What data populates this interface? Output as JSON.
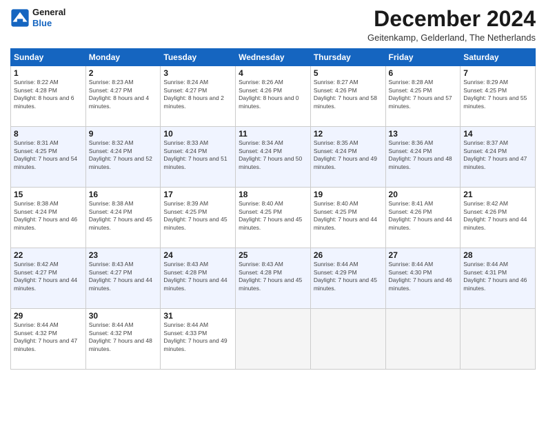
{
  "logo": {
    "line1": "General",
    "line2": "Blue"
  },
  "header": {
    "month": "December 2024",
    "location": "Geitenkamp, Gelderland, The Netherlands"
  },
  "weekdays": [
    "Sunday",
    "Monday",
    "Tuesday",
    "Wednesday",
    "Thursday",
    "Friday",
    "Saturday"
  ],
  "weeks": [
    [
      {
        "day": "1",
        "rise": "8:22 AM",
        "set": "4:28 PM",
        "daylight": "8 hours and 6 minutes."
      },
      {
        "day": "2",
        "rise": "8:23 AM",
        "set": "4:27 PM",
        "daylight": "8 hours and 4 minutes."
      },
      {
        "day": "3",
        "rise": "8:24 AM",
        "set": "4:27 PM",
        "daylight": "8 hours and 2 minutes."
      },
      {
        "day": "4",
        "rise": "8:26 AM",
        "set": "4:26 PM",
        "daylight": "8 hours and 0 minutes."
      },
      {
        "day": "5",
        "rise": "8:27 AM",
        "set": "4:26 PM",
        "daylight": "7 hours and 58 minutes."
      },
      {
        "day": "6",
        "rise": "8:28 AM",
        "set": "4:25 PM",
        "daylight": "7 hours and 57 minutes."
      },
      {
        "day": "7",
        "rise": "8:29 AM",
        "set": "4:25 PM",
        "daylight": "7 hours and 55 minutes."
      }
    ],
    [
      {
        "day": "8",
        "rise": "8:31 AM",
        "set": "4:25 PM",
        "daylight": "7 hours and 54 minutes."
      },
      {
        "day": "9",
        "rise": "8:32 AM",
        "set": "4:24 PM",
        "daylight": "7 hours and 52 minutes."
      },
      {
        "day": "10",
        "rise": "8:33 AM",
        "set": "4:24 PM",
        "daylight": "7 hours and 51 minutes."
      },
      {
        "day": "11",
        "rise": "8:34 AM",
        "set": "4:24 PM",
        "daylight": "7 hours and 50 minutes."
      },
      {
        "day": "12",
        "rise": "8:35 AM",
        "set": "4:24 PM",
        "daylight": "7 hours and 49 minutes."
      },
      {
        "day": "13",
        "rise": "8:36 AM",
        "set": "4:24 PM",
        "daylight": "7 hours and 48 minutes."
      },
      {
        "day": "14",
        "rise": "8:37 AM",
        "set": "4:24 PM",
        "daylight": "7 hours and 47 minutes."
      }
    ],
    [
      {
        "day": "15",
        "rise": "8:38 AM",
        "set": "4:24 PM",
        "daylight": "7 hours and 46 minutes."
      },
      {
        "day": "16",
        "rise": "8:38 AM",
        "set": "4:24 PM",
        "daylight": "7 hours and 45 minutes."
      },
      {
        "day": "17",
        "rise": "8:39 AM",
        "set": "4:25 PM",
        "daylight": "7 hours and 45 minutes."
      },
      {
        "day": "18",
        "rise": "8:40 AM",
        "set": "4:25 PM",
        "daylight": "7 hours and 45 minutes."
      },
      {
        "day": "19",
        "rise": "8:40 AM",
        "set": "4:25 PM",
        "daylight": "7 hours and 44 minutes."
      },
      {
        "day": "20",
        "rise": "8:41 AM",
        "set": "4:26 PM",
        "daylight": "7 hours and 44 minutes."
      },
      {
        "day": "21",
        "rise": "8:42 AM",
        "set": "4:26 PM",
        "daylight": "7 hours and 44 minutes."
      }
    ],
    [
      {
        "day": "22",
        "rise": "8:42 AM",
        "set": "4:27 PM",
        "daylight": "7 hours and 44 minutes."
      },
      {
        "day": "23",
        "rise": "8:43 AM",
        "set": "4:27 PM",
        "daylight": "7 hours and 44 minutes."
      },
      {
        "day": "24",
        "rise": "8:43 AM",
        "set": "4:28 PM",
        "daylight": "7 hours and 44 minutes."
      },
      {
        "day": "25",
        "rise": "8:43 AM",
        "set": "4:28 PM",
        "daylight": "7 hours and 45 minutes."
      },
      {
        "day": "26",
        "rise": "8:44 AM",
        "set": "4:29 PM",
        "daylight": "7 hours and 45 minutes."
      },
      {
        "day": "27",
        "rise": "8:44 AM",
        "set": "4:30 PM",
        "daylight": "7 hours and 46 minutes."
      },
      {
        "day": "28",
        "rise": "8:44 AM",
        "set": "4:31 PM",
        "daylight": "7 hours and 46 minutes."
      }
    ],
    [
      {
        "day": "29",
        "rise": "8:44 AM",
        "set": "4:32 PM",
        "daylight": "7 hours and 47 minutes."
      },
      {
        "day": "30",
        "rise": "8:44 AM",
        "set": "4:32 PM",
        "daylight": "7 hours and 48 minutes."
      },
      {
        "day": "31",
        "rise": "8:44 AM",
        "set": "4:33 PM",
        "daylight": "7 hours and 49 minutes."
      },
      null,
      null,
      null,
      null
    ]
  ]
}
